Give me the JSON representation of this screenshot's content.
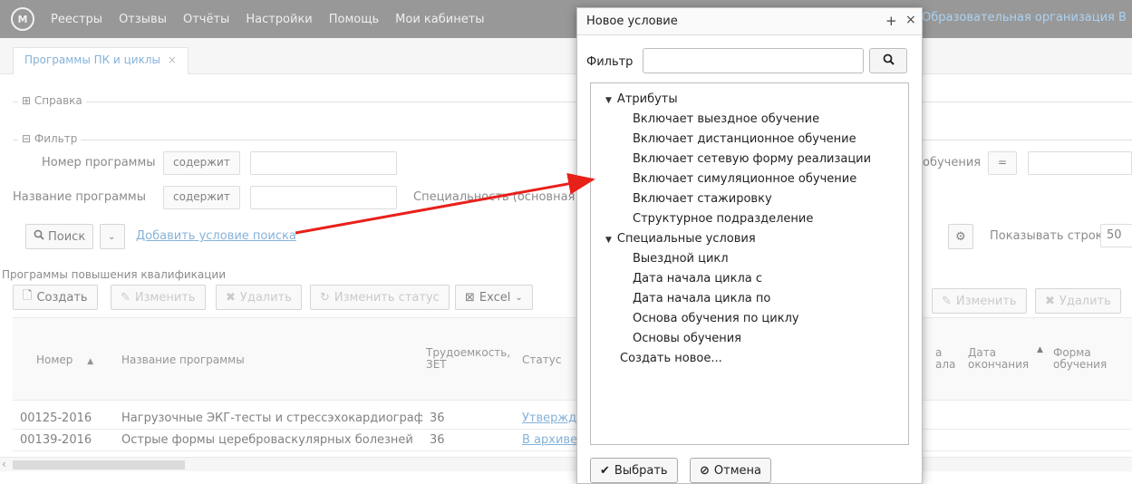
{
  "app": {
    "menu": [
      "Реестры",
      "Отзывы",
      "Отчёты",
      "Настройки",
      "Помощь",
      "Мои кабинеты"
    ],
    "org_link": "Образовательная организация В"
  },
  "tab": {
    "label": "Программы ПК и циклы",
    "close": "×"
  },
  "sections": {
    "help": "⊞ Справка",
    "filter": "⊟ Фильтр"
  },
  "filter": {
    "program_number_label": "Номер программы",
    "program_name_label": "Название программы",
    "contains": "содержит",
    "specialty_label": "Специальность (основная и",
    "form_label": "обучения",
    "eq": "="
  },
  "search": {
    "button": "Поиск",
    "add_condition": "Добавить условие поиска",
    "rows_label": "Показывать строк",
    "rows_value": "50"
  },
  "grid": {
    "title": "Программы повышения квалификации",
    "create": "Создать",
    "edit": "Изменить",
    "delete": "Удалить",
    "change_status": "Изменить статус",
    "excel": "Excel",
    "right_edit": "Изменить",
    "right_delete": "Удалить",
    "columns": {
      "number": "Номер",
      "name": "Название программы",
      "labor": "Трудоемкость, ЗЕТ",
      "status": "Статус",
      "start_fragment": "а ала",
      "end": "Дата окончания",
      "form": "Форма обучения"
    },
    "rows": [
      {
        "number": "00125-2016",
        "name": "Нагрузочные ЭКГ-тесты и стрессэхокардиография в",
        "labor": "36",
        "status": "Утвержде"
      },
      {
        "number": "00139-2016",
        "name": "Острые формы цереброваскулярных болезней",
        "labor": "36",
        "status": "В архиве"
      }
    ]
  },
  "dialog": {
    "title": "Новое условие",
    "plus": "+",
    "close": "×",
    "filter_label": "Фильтр",
    "filter_value": "",
    "tree": {
      "attributes": {
        "label": "Атрибуты",
        "items": [
          "Включает выездное обучение",
          "Включает дистанционное обучение",
          "Включает сетевую форму реализации",
          "Включает симуляционное обучение",
          "Включает стажировку",
          "Структурное подразделение"
        ]
      },
      "special": {
        "label": "Специальные условия",
        "items": [
          "Выездной цикл",
          "Дата начала цикла с",
          "Дата начала цикла по",
          "Основа обучения по циклу",
          "Основы обучения"
        ]
      },
      "create_new": "Создать новое..."
    },
    "select_button": "Выбрать",
    "cancel_button": "Отмена"
  },
  "colors": {
    "accent": "#3a83c3",
    "topbar": "#5a5a5a",
    "arrow": "#e8201a"
  }
}
